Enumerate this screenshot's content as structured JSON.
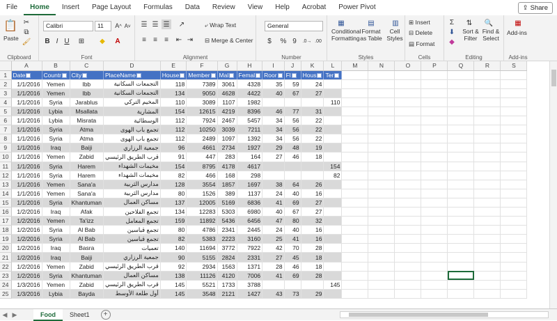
{
  "menu": {
    "tabs": [
      "File",
      "Home",
      "Insert",
      "Page Layout",
      "Formulas",
      "Data",
      "Review",
      "View",
      "Help",
      "Acrobat",
      "Power Pivot"
    ],
    "active": "Home",
    "share_label": "Share"
  },
  "ribbon": {
    "clipboard": {
      "label": "Clipboard",
      "paste": "Paste"
    },
    "font": {
      "label": "Font",
      "name": "Calibri",
      "size": "11"
    },
    "alignment": {
      "label": "Alignment",
      "wrap": "Wrap Text",
      "merge": "Merge & Center"
    },
    "number": {
      "label": "Number",
      "format": "General",
      "currency": "$",
      "percent": "%",
      "comma": "9"
    },
    "styles": {
      "label": "Styles",
      "conditional": "Conditional Formatting",
      "format_table": "Format as Table",
      "cell_styles": "Cell Styles"
    },
    "cells": {
      "label": "Cells",
      "insert": "Insert",
      "delete": "Delete",
      "format": "Format"
    },
    "editing": {
      "label": "Editing",
      "sort": "Sort & Filter",
      "find": "Find & Select"
    },
    "addins": {
      "label": "Add-ins",
      "btn": "Add-ins"
    }
  },
  "columns": [
    "A",
    "B",
    "C",
    "D",
    "E",
    "F",
    "G",
    "H",
    "I",
    "J",
    "K",
    "L",
    "M",
    "N",
    "O",
    "P",
    "Q",
    "R",
    "S"
  ],
  "headers": [
    "Date",
    "Countr",
    "City",
    "PlaceName",
    "House",
    "Member",
    "Mal",
    "Femal",
    "Roor",
    "Fl",
    "Hous",
    "Ter"
  ],
  "rows": [
    [
      "1/1/2016",
      "Yemen",
      "Ibb",
      "التجمعات السكانية",
      "118",
      "7389",
      "3061",
      "4328",
      "35",
      "59",
      "24",
      ""
    ],
    [
      "1/1/2016",
      "Yemen",
      "Ibb",
      "التجمعات السكانية",
      "134",
      "9050",
      "4628",
      "4422",
      "40",
      "67",
      "27",
      ""
    ],
    [
      "1/1/2016",
      "Syria",
      "Jarablus",
      "المخيم التركي",
      "110",
      "3089",
      "1107",
      "1982",
      "",
      "",
      "",
      "110"
    ],
    [
      "1/1/2016",
      "Lybia",
      "Msallata",
      "المشارية",
      "154",
      "12615",
      "4219",
      "8396",
      "46",
      "77",
      "31",
      ""
    ],
    [
      "1/1/2016",
      "Lybia",
      "Misrata",
      "الوسطائية",
      "112",
      "7924",
      "2467",
      "5457",
      "34",
      "56",
      "22",
      ""
    ],
    [
      "1/1/2016",
      "Syria",
      "Atma",
      "تجمع باب الهوى",
      "112",
      "10250",
      "3039",
      "7211",
      "34",
      "56",
      "22",
      ""
    ],
    [
      "1/1/2016",
      "Syria",
      "Atma",
      "تجمع باب الهوى",
      "112",
      "2489",
      "1097",
      "1392",
      "34",
      "56",
      "22",
      ""
    ],
    [
      "1/1/2016",
      "Iraq",
      "Baiji",
      "جمعية الرزاري",
      "96",
      "4661",
      "2734",
      "1927",
      "29",
      "48",
      "19",
      ""
    ],
    [
      "1/1/2016",
      "Yemen",
      "Zabid",
      "قرب الطريق الرئيسي",
      "91",
      "447",
      "283",
      "164",
      "27",
      "46",
      "18",
      ""
    ],
    [
      "1/1/2016",
      "Syria",
      "Harem",
      "مخيمات الشهداء",
      "154",
      "8795",
      "4178",
      "4617",
      "",
      "",
      "",
      "154"
    ],
    [
      "1/1/2016",
      "Syria",
      "Harem",
      "مخيمات الشهداء",
      "82",
      "466",
      "168",
      "298",
      "",
      "",
      "",
      "82"
    ],
    [
      "1/1/2016",
      "Yemen",
      "Sana'a",
      "مدارس الثربية",
      "128",
      "3554",
      "1857",
      "1697",
      "38",
      "64",
      "26",
      ""
    ],
    [
      "1/1/2016",
      "Yemen",
      "Sana'a",
      "مدارس الثربية",
      "80",
      "1526",
      "389",
      "1137",
      "24",
      "40",
      "16",
      ""
    ],
    [
      "1/1/2016",
      "Syria",
      "Khantuman",
      "مساكن العمال",
      "137",
      "12005",
      "5169",
      "6836",
      "41",
      "69",
      "27",
      ""
    ],
    [
      "1/2/2016",
      "Iraq",
      "Afak",
      "تجمع الفلاحين",
      "134",
      "12283",
      "5303",
      "6980",
      "40",
      "67",
      "27",
      ""
    ],
    [
      "1/2/2016",
      "Yemen",
      "Ta'izz",
      "تجمع المعامل",
      "159",
      "11892",
      "5436",
      "6456",
      "47",
      "80",
      "32",
      ""
    ],
    [
      "1/2/2016",
      "Syria",
      "Al Bab",
      "تجمع قباسين",
      "80",
      "4786",
      "2341",
      "2445",
      "24",
      "40",
      "16",
      ""
    ],
    [
      "1/2/2016",
      "Syria",
      "Al Bab",
      "تجمع قباسين",
      "82",
      "5383",
      "2223",
      "3160",
      "25",
      "41",
      "16",
      ""
    ],
    [
      "1/2/2016",
      "Iraq",
      "Basra",
      "تعميات",
      "140",
      "11694",
      "3772",
      "7922",
      "42",
      "70",
      "28",
      ""
    ],
    [
      "1/2/2016",
      "Iraq",
      "Baiji",
      "جمعية الرزاري",
      "90",
      "5155",
      "2824",
      "2331",
      "27",
      "45",
      "18",
      ""
    ],
    [
      "1/2/2016",
      "Yemen",
      "Zabid",
      "قرب الطريق الرئيسي",
      "92",
      "2934",
      "1563",
      "1371",
      "28",
      "46",
      "18",
      ""
    ],
    [
      "1/2/2016",
      "Syria",
      "Khantuman",
      "مساكن العمال",
      "138",
      "11126",
      "4120",
      "7006",
      "41",
      "69",
      "28",
      ""
    ],
    [
      "1/3/2016",
      "Yemen",
      "Zabid",
      "قرب الطريق الرئيسي",
      "145",
      "5521",
      "1733",
      "3788",
      "",
      "",
      "",
      "145"
    ],
    [
      "1/3/2016",
      "Lybia",
      "Bayda",
      "أول طلعة الأوسط",
      "145",
      "3548",
      "2121",
      "1427",
      "43",
      "73",
      "29",
      ""
    ]
  ],
  "sheets": [
    "Food",
    "Sheet1"
  ],
  "active_sheet": "Food"
}
